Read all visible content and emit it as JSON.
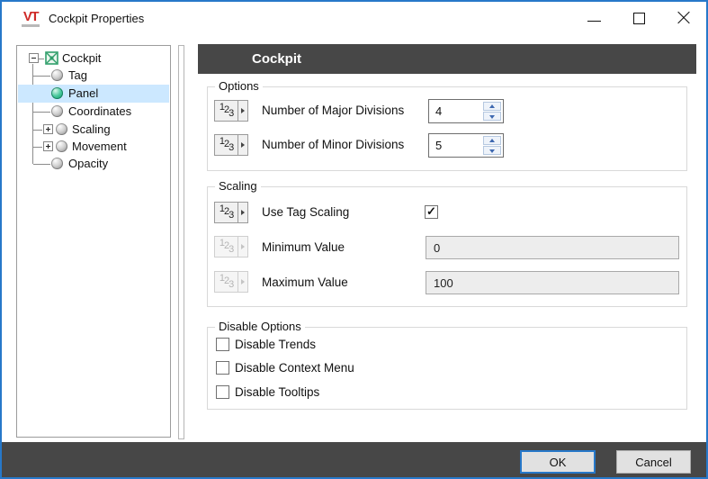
{
  "window": {
    "logo": "VT",
    "title": "Cockpit Properties"
  },
  "tree": {
    "root": {
      "label": "Cockpit"
    },
    "items": [
      {
        "label": "Tag",
        "selected": false
      },
      {
        "label": "Panel",
        "selected": true
      },
      {
        "label": "Coordinates",
        "selected": false
      },
      {
        "label": "Scaling",
        "selected": false,
        "expandable": true
      },
      {
        "label": "Movement",
        "selected": false,
        "expandable": true
      },
      {
        "label": "Opacity",
        "selected": false
      }
    ]
  },
  "header": {
    "title": "Cockpit"
  },
  "options_group": {
    "label": "Options",
    "rows": [
      {
        "label": "Number of Major Divisions",
        "value": "4"
      },
      {
        "label": "Number of Minor Divisions",
        "value": "5"
      }
    ]
  },
  "scaling_group": {
    "label": "Scaling",
    "use_tag_scaling": {
      "label": "Use Tag Scaling",
      "checked": true
    },
    "minimum": {
      "label": "Minimum Value",
      "value": "0",
      "disabled": true
    },
    "maximum": {
      "label": "Maximum Value",
      "value": "100",
      "disabled": true
    }
  },
  "disable_group": {
    "label": "Disable Options",
    "checkboxes": [
      {
        "label": "Disable Trends",
        "checked": false
      },
      {
        "label": "Disable Context Menu",
        "checked": false
      },
      {
        "label": "Disable Tooltips",
        "checked": false
      }
    ]
  },
  "footer": {
    "ok_label": "OK",
    "cancel_label": "Cancel"
  },
  "icons": {
    "numeric": [
      "1",
      "2",
      "3"
    ],
    "check": "✓"
  },
  "colors": {
    "window_border": "#2778c9",
    "header_bar": "#474747",
    "footer_bar": "#474747",
    "tree_selection": "#cce8ff",
    "ok_focus_border": "#2778c9",
    "panel_node_green": "#17996d",
    "logo_red": "#cf2a27"
  }
}
